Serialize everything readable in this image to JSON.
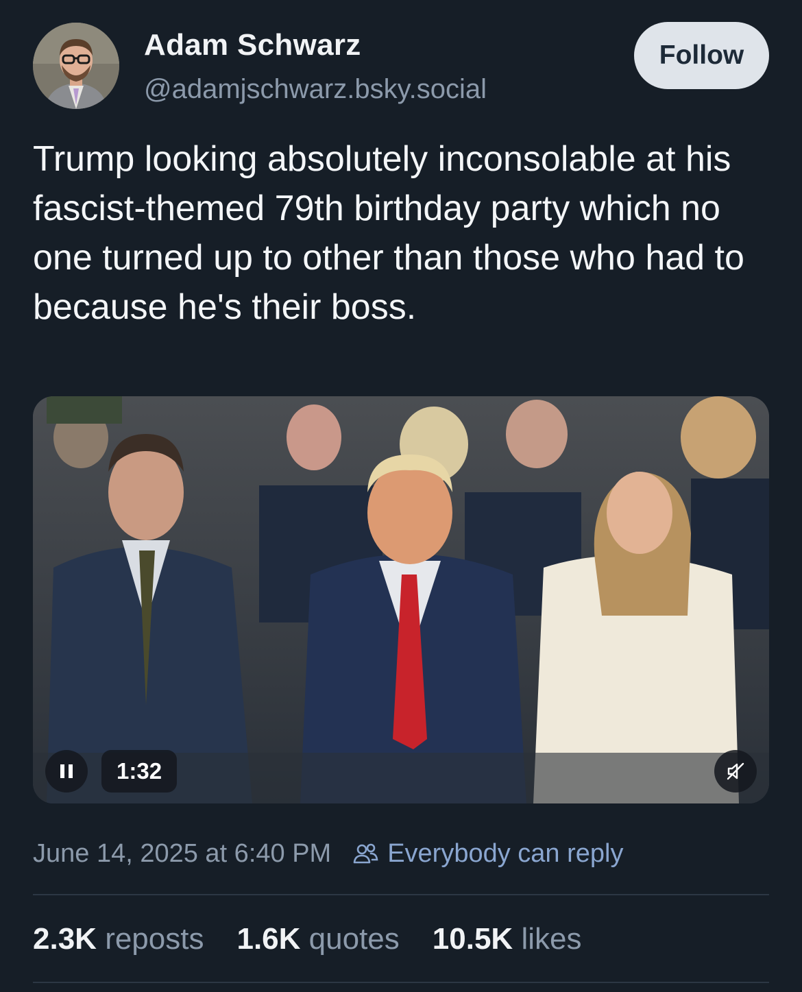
{
  "author": {
    "display_name": "Adam Schwarz",
    "handle": "@adamjschwarz.bsky.social",
    "follow_label": "Follow"
  },
  "post": {
    "text": "Trump looking absolutely inconsolable at his fascist-themed 79th birthday party which no one turned up to other than those who had to because he's their boss."
  },
  "video": {
    "duration": "1:32",
    "pause_icon": "pause-icon",
    "mute_icon": "muted-speaker-icon"
  },
  "meta": {
    "timestamp": "June 14, 2025 at 6:40 PM",
    "reply_setting": "Everybody can reply",
    "reply_icon": "people-icon"
  },
  "stats": {
    "reposts_count": "2.3K",
    "reposts_label": "reposts",
    "quotes_count": "1.6K",
    "quotes_label": "quotes",
    "likes_count": "10.5K",
    "likes_label": "likes"
  },
  "colors": {
    "background": "#161e27",
    "muted_text": "#8c9aab",
    "accent_text": "#8aa6d0",
    "follow_button_bg": "#dfe4ea",
    "tie_red": "#c8232b"
  }
}
